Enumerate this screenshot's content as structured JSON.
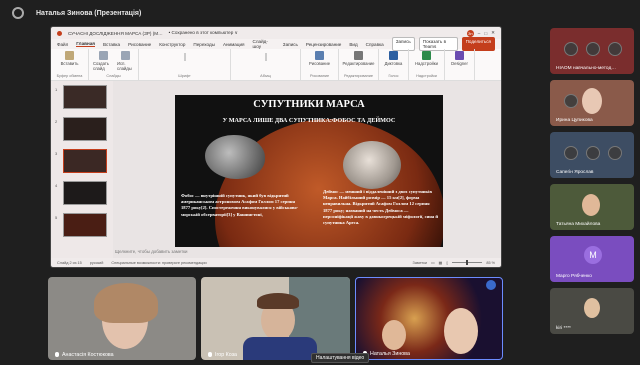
{
  "meeting": {
    "title": "Наталья Зинова (Презентація)"
  },
  "powerpoint": {
    "file_title": "СУЧАСНІ ДОСЛІДЖЕННЯ МАРСА (ЗР) (М…",
    "save_status": "• Сохранено в этот компьютер ∨",
    "user_initials": "Зн",
    "tabs": [
      "Файл",
      "Главная",
      "Вставка",
      "Рисование",
      "Конструктор",
      "Переходы",
      "Анимация",
      "Слайд-шоу",
      "Запись",
      "Рецензирование",
      "Вид",
      "Справка"
    ],
    "active_tab": "Главная",
    "btn_record": "Запись",
    "btn_present": "Показать в Teams",
    "btn_share": "Поделиться",
    "ribbon_groups": [
      {
        "label": "Буфер обмена",
        "icons": [
          {
            "name": "paste-icon",
            "text": "Вставить",
            "color": "#c0a878"
          }
        ]
      },
      {
        "label": "Слайды",
        "icons": [
          {
            "name": "new-slide-icon",
            "text": "Создать слайд",
            "color": "#9aa5b5"
          },
          {
            "name": "reuse-slide-icon",
            "text": "Исп. слайды",
            "color": "#9aa5b5"
          }
        ]
      },
      {
        "label": "Шрифт",
        "icons": []
      },
      {
        "label": "Абзац",
        "icons": []
      },
      {
        "label": "Рисование",
        "icons": [
          {
            "name": "shapes-icon",
            "text": "Рисование",
            "color": "#5b7fb0"
          }
        ]
      },
      {
        "label": "Редактирование",
        "icons": [
          {
            "name": "edit-icon",
            "text": "Редактирование",
            "color": "#777777"
          }
        ]
      },
      {
        "label": "Голос",
        "icons": [
          {
            "name": "dictation-icon",
            "text": "Диктовка",
            "color": "#2d5fa0"
          }
        ]
      },
      {
        "label": "Надстройки",
        "icons": [
          {
            "name": "addins-icon",
            "text": "Надстройки",
            "color": "#2d8a4a"
          }
        ]
      },
      {
        "label": "",
        "icons": [
          {
            "name": "designer-icon",
            "text": "Designer",
            "color": "#6a4cb0"
          }
        ]
      }
    ],
    "slide_numbers": [
      "1",
      "2",
      "3",
      "4",
      "5"
    ],
    "slide": {
      "heading": "СУПУТНИКИ МАРСА",
      "subheading": "У МАРСА ЛИШЕ ДВА СУПУТНИКА:ФОБОС ТА ДЕЙМОС",
      "left_text": "Фобос — внутрішній супутник, який був відкритий американським астрономом Асафом Голлом 17 серпня 1877 року[2]. Спостереження виконувалися у військово-морській обсерваторії[3] у Вашингтоні,",
      "right_text": "Деймос — менший і віддаленіший з двох супутників Марса. Найбільший розмір — 15 км[2], форма неправильна. Відкритий Асафом Голлом 12 серпня 1877 року; названий на честь Деймоса — персоніфікації жаху в давньогрецькій міфології, сина й супутника Ареса."
    },
    "notes_placeholder": "Щелкните, чтобы добавить заметки",
    "status": {
      "slide_counter": "Слайд 2 из 15",
      "language": "русский",
      "accessibility": "Специальные возможности: проверьте рекомендации",
      "notes_label": "Заметки",
      "zoom": "85 %"
    }
  },
  "participants_bottom": [
    {
      "name": "Анастасія Костюкова"
    },
    {
      "name": "Ігор Коза"
    },
    {
      "name": "Наталья Зинова"
    }
  ],
  "participants_side": [
    {
      "name": "НІАОМ навчально-метод…",
      "bg": "#7a2d2d"
    },
    {
      "name": "Ирина Цупикова",
      "bg": "#8a5a4a"
    },
    {
      "name": "Сапегін Ярослав",
      "bg": "#3d4d63"
    },
    {
      "name": "Татьяна Михайлова",
      "bg": "#4d5a3a"
    },
    {
      "name": "Марго Рябченко",
      "bg": "#7a4dbf",
      "initial": "M"
    },
    {
      "name": "kiri ****",
      "bg": "#4a4a44"
    }
  ],
  "tooltip": "Налаштування відео"
}
